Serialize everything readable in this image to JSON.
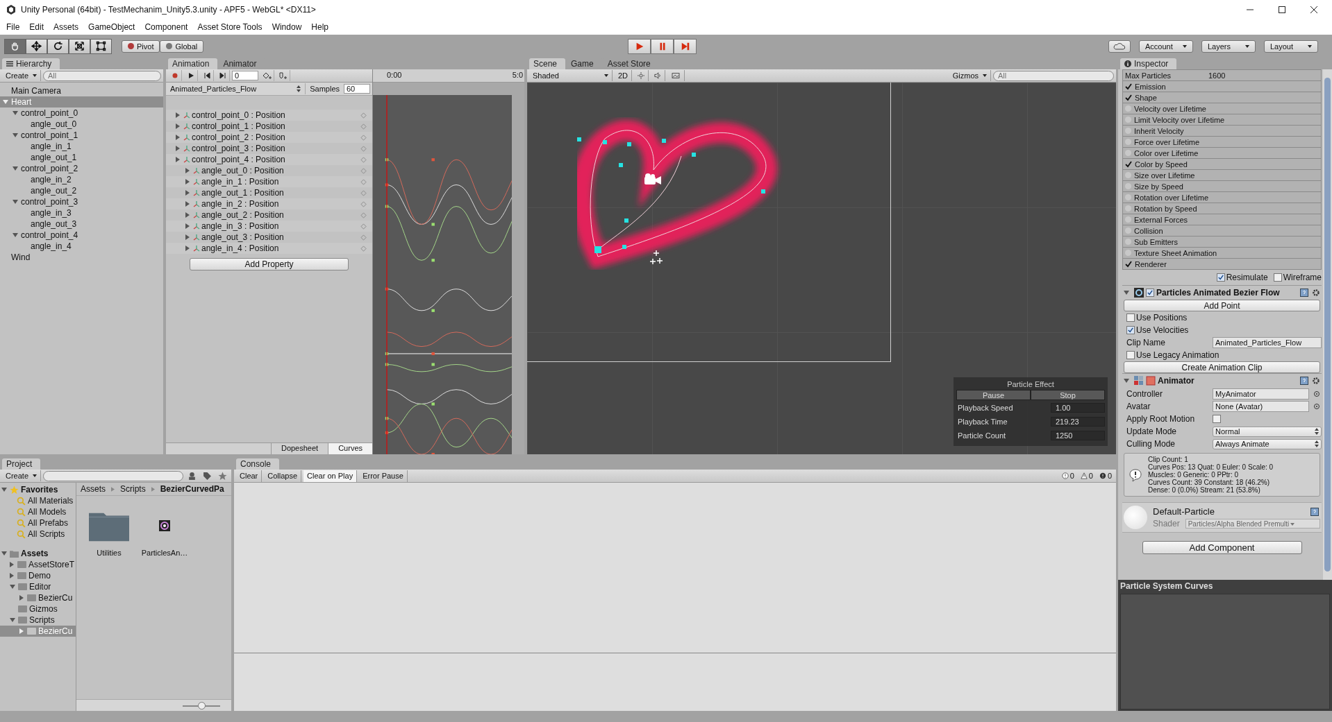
{
  "window": {
    "title": "Unity Personal (64bit) - TestMechanim_Unity5.3.unity - APF5 - WebGL* <DX11>"
  },
  "menu": [
    "File",
    "Edit",
    "Assets",
    "GameObject",
    "Component",
    "Asset Store Tools",
    "Window",
    "Help"
  ],
  "toolbar": {
    "tools": [
      {
        "kind": "hand",
        "selected": true
      },
      {
        "kind": "move",
        "selected": false
      },
      {
        "kind": "rotate",
        "selected": false
      },
      {
        "kind": "scale",
        "selected": false
      },
      {
        "kind": "rect",
        "selected": false
      }
    ],
    "pivot": "Pivot",
    "space": "Global",
    "playback": [
      {
        "kind": "play"
      },
      {
        "kind": "pause"
      },
      {
        "kind": "step"
      }
    ],
    "account": "Account",
    "layers": "Layers",
    "layout": "Layout"
  },
  "hierarchy": {
    "title": "Hierarchy",
    "create": "Create",
    "search": {
      "placeholder": "All"
    },
    "items": [
      {
        "label": "Main Camera",
        "selected": false
      },
      {
        "label": "Heart",
        "selected": true,
        "expanded": true,
        "children": [
          {
            "label": "control_point_0",
            "selected": false,
            "expanded": true,
            "children": [
              {
                "label": "angle_out_0",
                "selected": false
              }
            ]
          },
          {
            "label": "control_point_1",
            "selected": false,
            "expanded": true,
            "children": [
              {
                "label": "angle_in_1",
                "selected": false
              },
              {
                "label": "angle_out_1",
                "selected": false
              }
            ]
          },
          {
            "label": "control_point_2",
            "selected": false,
            "expanded": true,
            "children": [
              {
                "label": "angle_in_2",
                "selected": false
              },
              {
                "label": "angle_out_2",
                "selected": false
              }
            ]
          },
          {
            "label": "control_point_3",
            "selected": false,
            "expanded": true,
            "children": [
              {
                "label": "angle_in_3",
                "selected": false
              },
              {
                "label": "angle_out_3",
                "selected": false
              }
            ]
          },
          {
            "label": "control_point_4",
            "selected": false,
            "expanded": true,
            "children": [
              {
                "label": "angle_in_4",
                "selected": false
              }
            ]
          }
        ]
      },
      {
        "label": "Wind",
        "selected": false
      }
    ]
  },
  "animation": {
    "tabs": [
      {
        "label": "Animation",
        "selected": true
      },
      {
        "label": "Animator",
        "selected": false
      }
    ],
    "frame": "0",
    "clip": "Animated_Particles_Flow",
    "samples_label": "Samples",
    "samples": "60",
    "ruler": [
      "0:00",
      "5:0"
    ],
    "properties": [
      {
        "kind": "point",
        "label": "control_point_0 : Position"
      },
      {
        "kind": "point",
        "label": "control_point_1 : Position"
      },
      {
        "kind": "point",
        "label": "control_point_2 : Position"
      },
      {
        "kind": "point",
        "label": "control_point_3 : Position"
      },
      {
        "kind": "point",
        "label": "control_point_4 : Position"
      },
      {
        "kind": "angle",
        "label": "angle_out_0 : Position"
      },
      {
        "kind": "angle",
        "label": "angle_in_1 : Position"
      },
      {
        "kind": "angle",
        "label": "angle_out_1 : Position"
      },
      {
        "kind": "angle",
        "label": "angle_in_2 : Position"
      },
      {
        "kind": "angle",
        "label": "angle_out_2 : Position"
      },
      {
        "kind": "angle",
        "label": "angle_in_3 : Position"
      },
      {
        "kind": "angle",
        "label": "angle_out_3 : Position"
      },
      {
        "kind": "angle",
        "label": "angle_in_4 : Position"
      }
    ],
    "add_property": "Add Property",
    "view_tabs": [
      {
        "label": "Dopesheet",
        "selected": false
      },
      {
        "label": "Curves",
        "selected": true
      }
    ]
  },
  "scene": {
    "tabs": [
      {
        "label": "Scene",
        "selected": true
      },
      {
        "label": "Game",
        "selected": false
      },
      {
        "label": "Asset Store",
        "selected": false
      }
    ],
    "shading": "Shaded",
    "mode_2d": "2D",
    "gizmos": "Gizmos",
    "search": {
      "placeholder": "All"
    },
    "particle_effect": {
      "title": "Particle Effect",
      "buttons": [
        "Pause",
        "Stop"
      ],
      "rows": [
        {
          "label": "Playback Speed",
          "value": "1.00"
        },
        {
          "label": "Playback Time",
          "value": "219.23"
        },
        {
          "label": "Particle Count",
          "value": "1250"
        }
      ]
    }
  },
  "inspector": {
    "title": "Inspector",
    "max_particles": {
      "label": "Max Particles",
      "value": "1600"
    },
    "modules": [
      {
        "label": "Emission",
        "checked": true
      },
      {
        "label": "Shape",
        "checked": true
      },
      {
        "label": "Velocity over Lifetime",
        "checked": false
      },
      {
        "label": "Limit Velocity over Lifetime",
        "checked": false
      },
      {
        "label": "Inherit Velocity",
        "checked": false
      },
      {
        "label": "Force over Lifetime",
        "checked": false
      },
      {
        "label": "Color over Lifetime",
        "checked": false
      },
      {
        "label": "Color by Speed",
        "checked": true
      },
      {
        "label": "Size over Lifetime",
        "checked": false
      },
      {
        "label": "Size by Speed",
        "checked": false
      },
      {
        "label": "Rotation over Lifetime",
        "checked": false
      },
      {
        "label": "Rotation by Speed",
        "checked": false
      },
      {
        "label": "External Forces",
        "checked": false
      },
      {
        "label": "Collision",
        "checked": false
      },
      {
        "label": "Sub Emitters",
        "checked": false
      },
      {
        "label": "Texture Sheet Animation",
        "checked": false
      },
      {
        "label": "Renderer",
        "checked": true
      }
    ],
    "resimulate": {
      "label": "Resimulate",
      "checked": true
    },
    "wireframe": {
      "label": "Wireframe",
      "checked": false
    },
    "bezier": {
      "title": "Particles Animated Bezier Flow",
      "enabled": true,
      "expanded": true,
      "add_point": "Add Point",
      "options": [
        {
          "label": "Use Positions",
          "checked": false
        },
        {
          "label": "Use Velocities",
          "checked": true
        }
      ],
      "clip_name": {
        "label": "Clip Name",
        "value": "Animated_Particles_Flow"
      },
      "legacy": {
        "label": "Use Legacy Animation",
        "checked": false
      },
      "create_clip": "Create Animation Clip"
    },
    "animator": {
      "title": "Animator",
      "expanded": true,
      "fields": [
        {
          "kind": "object",
          "label": "Controller",
          "value": "MyAnimator"
        },
        {
          "kind": "object",
          "label": "Avatar",
          "value": "None (Avatar)"
        },
        {
          "kind": "toggle",
          "label": "Apply Root Motion",
          "checked": false
        },
        {
          "kind": "dropdown",
          "label": "Update Mode",
          "value": "Normal"
        },
        {
          "kind": "dropdown",
          "label": "Culling Mode",
          "value": "Always Animate"
        }
      ],
      "info": [
        "Clip Count: 1",
        "Curves Pos: 13 Quat: 0 Euler: 0 Scale: 0",
        "Muscles: 0 Generic: 0 PPtr: 0",
        "Curves Count: 39 Constant: 18 (46.2%)",
        "Dense: 0 (0.0%) Stream: 21 (53.8%)"
      ]
    },
    "material": {
      "name": "Default-Particle",
      "shader_label": "Shader",
      "shader": "Particles/Alpha Blended Premulti"
    },
    "add_component": "Add Component",
    "curves_title": "Particle System Curves"
  },
  "project": {
    "title": "Project",
    "create": "Create",
    "favorites": {
      "label": "Favorites",
      "expanded": true,
      "items": [
        "All Materials",
        "All Models",
        "All Prefabs",
        "All Scripts"
      ]
    },
    "assets": {
      "label": "Assets",
      "expanded": true,
      "items": [
        {
          "label": "AssetStoreT",
          "selected": false,
          "expanded": false
        },
        {
          "label": "Demo",
          "selected": false,
          "expanded": false
        },
        {
          "label": "Editor",
          "selected": false,
          "expanded": true,
          "children": [
            {
              "label": "BezierCu",
              "selected": false,
              "expanded": false
            }
          ]
        },
        {
          "label": "Gizmos",
          "selected": false
        },
        {
          "label": "Scripts",
          "selected": false,
          "expanded": true,
          "children": [
            {
              "label": "BezierCu",
              "selected": true,
              "expanded": false
            }
          ]
        }
      ]
    },
    "breadcrumb": [
      "Assets",
      "Scripts",
      "BezierCurvedPa"
    ],
    "files": [
      {
        "kind": "folder",
        "label": "Utilities"
      },
      {
        "kind": "script",
        "label": "ParticlesAn…"
      }
    ],
    "icon_size": {
      "level": 0.5
    }
  },
  "console": {
    "title": "Console",
    "buttons": [
      {
        "label": "Clear",
        "selected": false
      },
      {
        "label": "Collapse",
        "selected": false
      },
      {
        "label": "Clear on Play",
        "selected": true
      },
      {
        "label": "Error Pause",
        "selected": false
      }
    ],
    "counts": [
      {
        "kind": "info",
        "value": "0"
      },
      {
        "kind": "warning",
        "value": "0"
      },
      {
        "kind": "error",
        "value": "0"
      }
    ]
  }
}
